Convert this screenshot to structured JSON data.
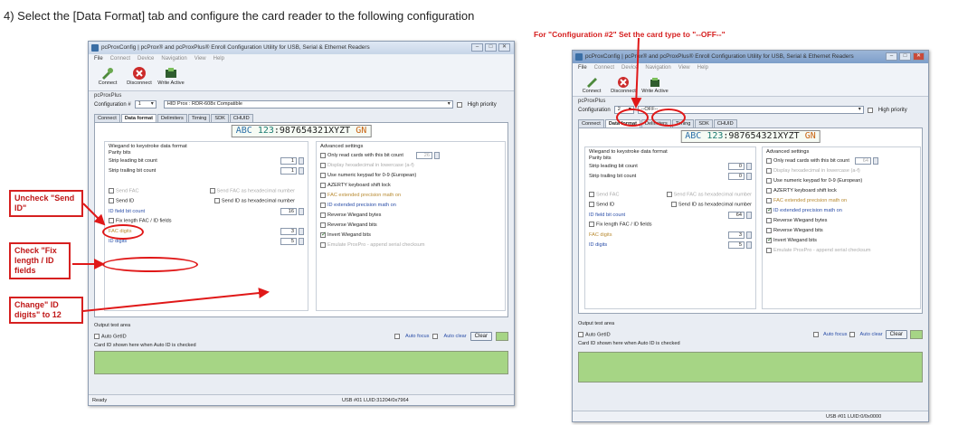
{
  "heading": "4) Select the [Data Format] tab and configure the card reader to the following configuration",
  "callouts": {
    "config2": "For \"Configuration #2\" Set the card type to \"--OFF--\"",
    "uncheck": "Uncheck \"Send ID\"",
    "check": "Check \"Fix length / ID fields",
    "change": "Change\" ID digits\" to 12"
  },
  "app": {
    "title": "pcProxConfig | pcProx® and pcProxPlus® Enroll Configuration Utility for USB, Serial & Ethernet Readers",
    "menu": [
      "File",
      "Connect",
      "Device",
      "Navigation",
      "View",
      "Help"
    ],
    "toolbar": {
      "connect": "Connect",
      "disconnect": "Disconnect",
      "write": "Write Active"
    },
    "device": "pcProxPlus",
    "config_label": "Configuration #",
    "high_priority": "High priority",
    "tabs": [
      "Connect",
      "Data format",
      "Delimiters",
      "Timing",
      "SDK",
      "CHUID"
    ],
    "banner": {
      "a": "ABC",
      "b": "123",
      "c": ":",
      "d": "987654321XYZT",
      "e": "GN"
    },
    "wiegand": {
      "title": "Wiegand to keystroke data format",
      "parity": "Parity bits",
      "strip_lead": "Strip leading bit count",
      "strip_trail": "Strip trailing bit count",
      "send_fac": "Send FAC",
      "send_fac_hex": "Send FAC as hexadecimal number",
      "send_id": "Send ID",
      "send_id_hex": "Send ID as hexadecimal number",
      "id_field_bits": "ID field bit count",
      "fix_length": "Fix length FAC / ID fields",
      "fac_digits": "FAC digits",
      "id_digits": "ID digits"
    },
    "adv": {
      "title": "Advanced settings",
      "items": [
        "Only read cards with this bit count",
        "Display hexadecimal in lowercase (a-f)",
        "Use numeric keypad for 0-9 (European)",
        "AZERTY keyboard shift lock",
        "FAC extended precision math on",
        "ID extended precision math on",
        "Reverse Wiegand bytes",
        "Reverse Wiegand bits",
        "Invert Wiegand bits",
        "Emulate ProxPro - append serial checksum"
      ]
    },
    "output": {
      "title": "Output test area",
      "auto_getid": "Auto GetID",
      "note": "Card ID shown here when Auto ID is checked",
      "auto_focus": "Auto focus",
      "auto_clear": "Auto clear",
      "clear": "Clear"
    }
  },
  "left": {
    "config_num": "1",
    "card_type": "HID Prox : RDR-608x Compatible",
    "strip_lead": "1",
    "strip_trail": "1",
    "only_count": "26",
    "id_bits": "16",
    "fac_digits": "3",
    "id_digits": "5",
    "status_ready": "Ready",
    "status_usb": "USB #01 LUID:31204/0x7964"
  },
  "right": {
    "config_num": "2",
    "card_type": "--OFF--",
    "strip_lead": "0",
    "strip_trail": "0",
    "only_count": "64",
    "id_bits": "64",
    "fac_digits": "3",
    "id_digits": "5",
    "status_usb": "USB #01 LUID:0/0x0000"
  }
}
